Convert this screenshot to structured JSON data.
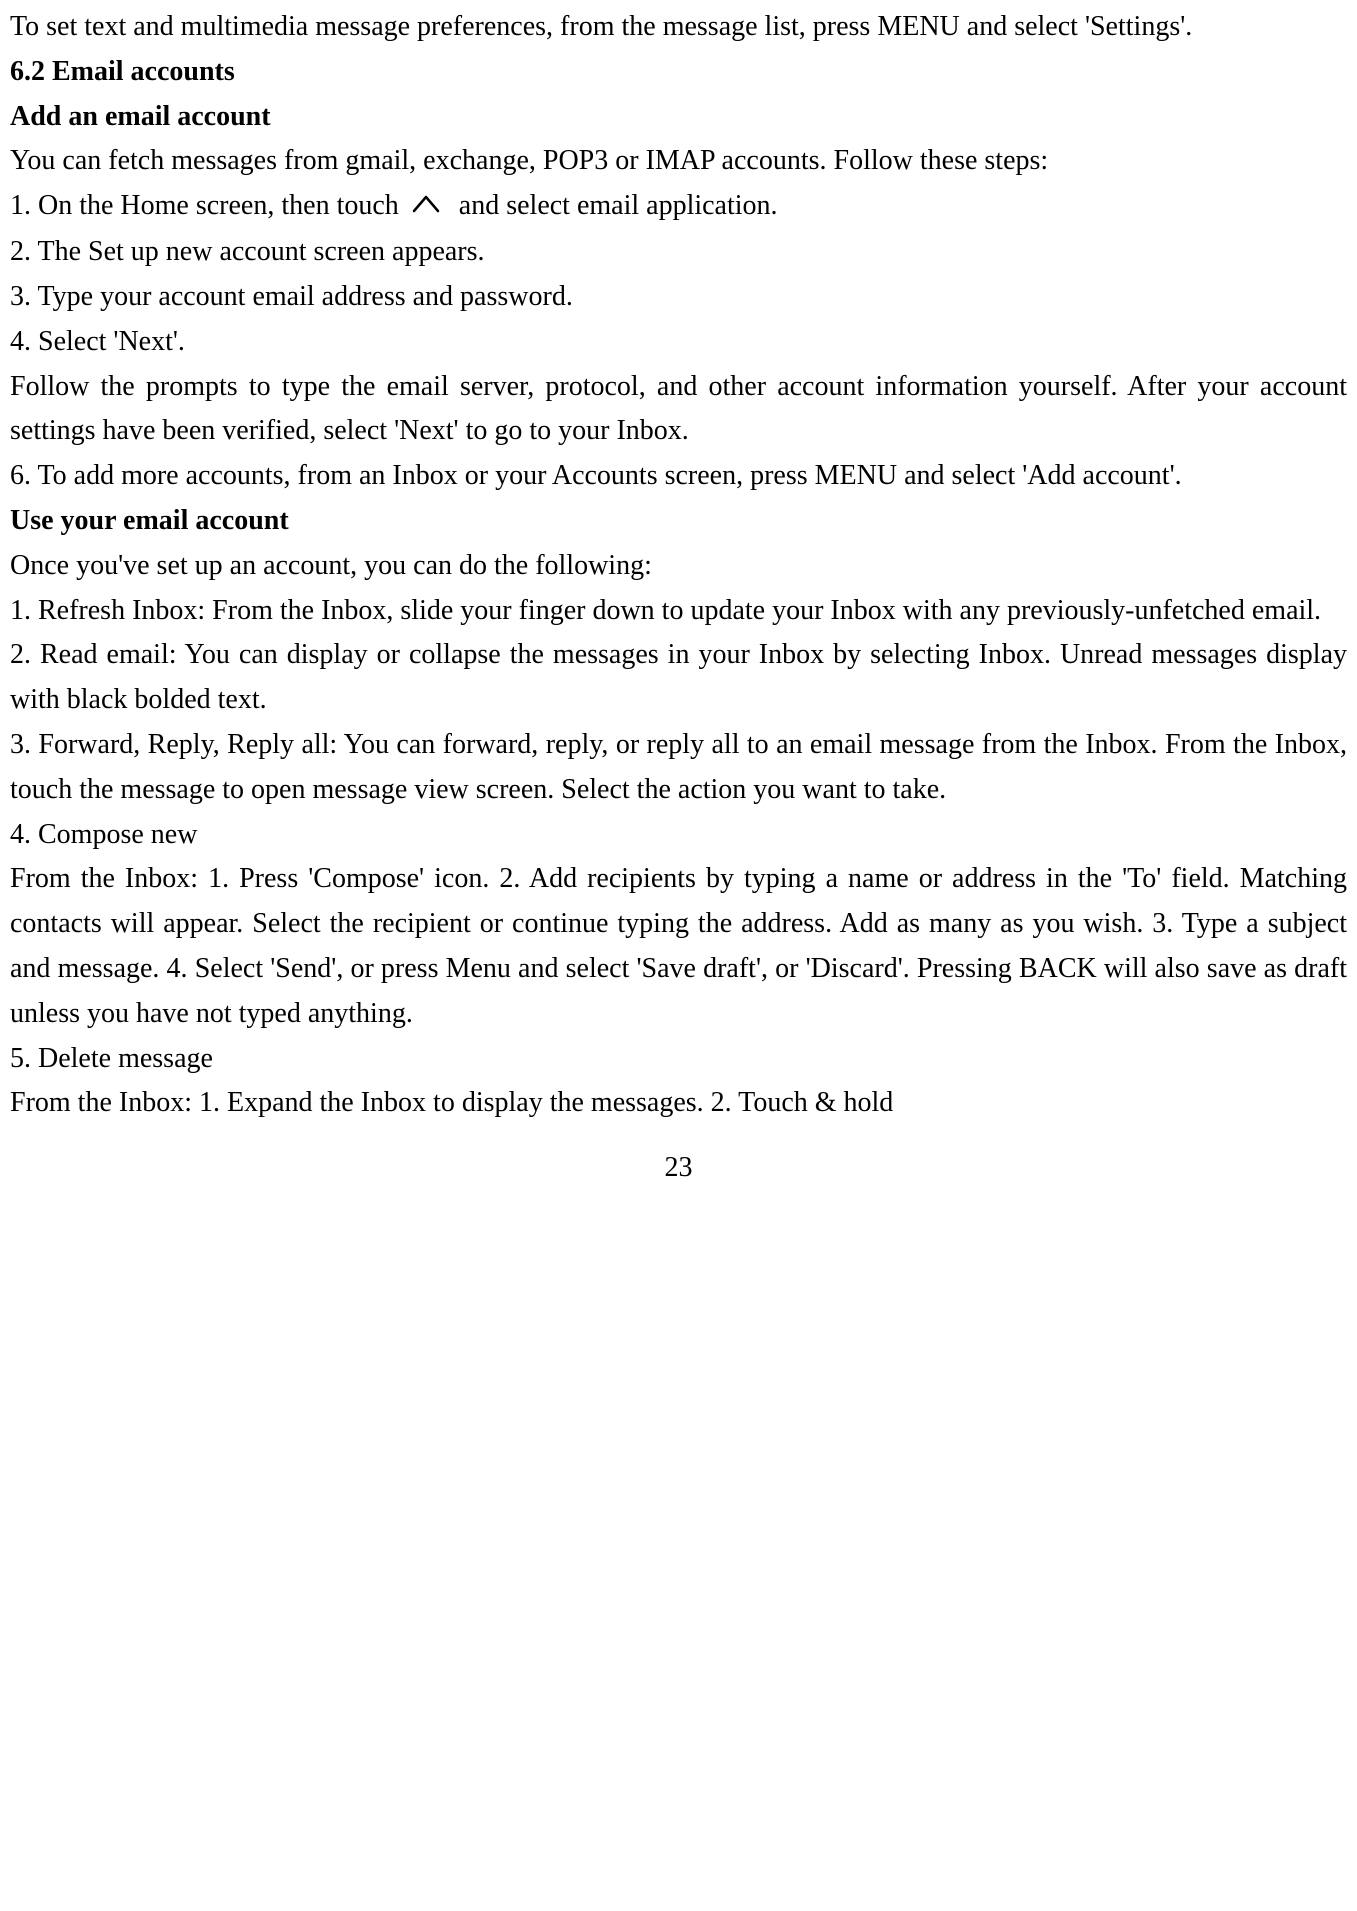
{
  "p1": "To set text and multimedia message preferences, from the message list, press MENU and select 'Settings'.",
  "h1": "6.2 Email accounts",
  "h2": "Add an email account",
  "p2": "You can fetch messages from gmail, exchange, POP3 or IMAP accounts. Follow these steps:",
  "p3_before": "1. On the Home screen, then touch ",
  "p3_after": " and select email application.",
  "p4": "2. The Set up new account screen appears.",
  "p5": "3. Type your account email address and password.",
  "p6": "4. Select 'Next'.",
  "p7": "Follow the prompts to type the email server, protocol, and other account information yourself. After your account settings have been verified, select 'Next' to go to your Inbox.",
  "p8": "6. To add more accounts, from an Inbox or your Accounts screen, press MENU and select 'Add account'.",
  "h3": "Use your email account",
  "p9": "Once you've set up an account, you can do the following:",
  "p10": "1. Refresh Inbox: From the Inbox, slide your finger down to update your Inbox with any previously-unfetched email.",
  "p11": "2. Read email: You can display or collapse the messages in your Inbox by selecting Inbox. Unread messages display with black bolded text.",
  "p12": "3. Forward, Reply, Reply all: You can forward, reply, or reply all to an email message from the Inbox. From the Inbox, touch the message to open message view screen. Select the action you want to take.",
  "p13": "4. Compose new",
  "p14": "From the Inbox: 1. Press 'Compose' icon. 2. Add recipients by typing a name or address in the 'To' field. Matching contacts will appear. Select the recipient or continue typing the address. Add as many as you wish. 3. Type a subject and message. 4. Select 'Send', or press Menu and select 'Save draft', or 'Discard'. Pressing BACK will also save as draft unless you have not typed anything.",
  "p15": "5. Delete message",
  "p16": "From the Inbox: 1. Expand the Inbox to display the messages. 2. Touch & hold",
  "page_number": "23"
}
